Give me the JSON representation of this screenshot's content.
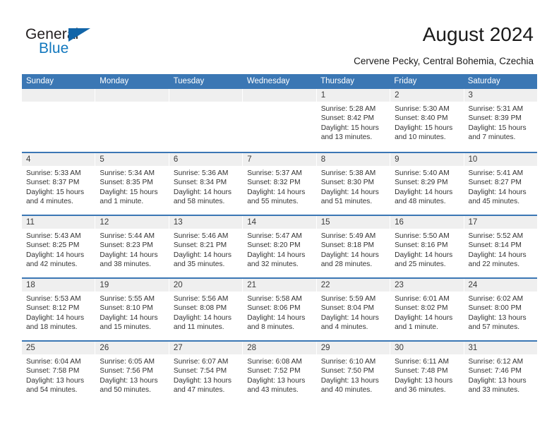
{
  "brand": {
    "name_top": "General",
    "name_bottom": "Blue",
    "accent_color": "#1278be",
    "triangle_color": "#1265a8"
  },
  "header": {
    "title": "August 2024",
    "subtitle": "Cervene Pecky, Central Bohemia, Czechia"
  },
  "theme": {
    "header_blue": "#3b77b4",
    "daynum_band_gray": "#efefef",
    "text_color": "#333333"
  },
  "weekdays": [
    "Sunday",
    "Monday",
    "Tuesday",
    "Wednesday",
    "Thursday",
    "Friday",
    "Saturday"
  ],
  "weeks": [
    [
      {
        "day": "",
        "empty": true
      },
      {
        "day": "",
        "empty": true
      },
      {
        "day": "",
        "empty": true
      },
      {
        "day": "",
        "empty": true
      },
      {
        "day": "1",
        "sunrise": "Sunrise: 5:28 AM",
        "sunset": "Sunset: 8:42 PM",
        "daylight1": "Daylight: 15 hours",
        "daylight2": "and 13 minutes."
      },
      {
        "day": "2",
        "sunrise": "Sunrise: 5:30 AM",
        "sunset": "Sunset: 8:40 PM",
        "daylight1": "Daylight: 15 hours",
        "daylight2": "and 10 minutes."
      },
      {
        "day": "3",
        "sunrise": "Sunrise: 5:31 AM",
        "sunset": "Sunset: 8:39 PM",
        "daylight1": "Daylight: 15 hours",
        "daylight2": "and 7 minutes."
      }
    ],
    [
      {
        "day": "4",
        "sunrise": "Sunrise: 5:33 AM",
        "sunset": "Sunset: 8:37 PM",
        "daylight1": "Daylight: 15 hours",
        "daylight2": "and 4 minutes."
      },
      {
        "day": "5",
        "sunrise": "Sunrise: 5:34 AM",
        "sunset": "Sunset: 8:35 PM",
        "daylight1": "Daylight: 15 hours",
        "daylight2": "and 1 minute."
      },
      {
        "day": "6",
        "sunrise": "Sunrise: 5:36 AM",
        "sunset": "Sunset: 8:34 PM",
        "daylight1": "Daylight: 14 hours",
        "daylight2": "and 58 minutes."
      },
      {
        "day": "7",
        "sunrise": "Sunrise: 5:37 AM",
        "sunset": "Sunset: 8:32 PM",
        "daylight1": "Daylight: 14 hours",
        "daylight2": "and 55 minutes."
      },
      {
        "day": "8",
        "sunrise": "Sunrise: 5:38 AM",
        "sunset": "Sunset: 8:30 PM",
        "daylight1": "Daylight: 14 hours",
        "daylight2": "and 51 minutes."
      },
      {
        "day": "9",
        "sunrise": "Sunrise: 5:40 AM",
        "sunset": "Sunset: 8:29 PM",
        "daylight1": "Daylight: 14 hours",
        "daylight2": "and 48 minutes."
      },
      {
        "day": "10",
        "sunrise": "Sunrise: 5:41 AM",
        "sunset": "Sunset: 8:27 PM",
        "daylight1": "Daylight: 14 hours",
        "daylight2": "and 45 minutes."
      }
    ],
    [
      {
        "day": "11",
        "sunrise": "Sunrise: 5:43 AM",
        "sunset": "Sunset: 8:25 PM",
        "daylight1": "Daylight: 14 hours",
        "daylight2": "and 42 minutes."
      },
      {
        "day": "12",
        "sunrise": "Sunrise: 5:44 AM",
        "sunset": "Sunset: 8:23 PM",
        "daylight1": "Daylight: 14 hours",
        "daylight2": "and 38 minutes."
      },
      {
        "day": "13",
        "sunrise": "Sunrise: 5:46 AM",
        "sunset": "Sunset: 8:21 PM",
        "daylight1": "Daylight: 14 hours",
        "daylight2": "and 35 minutes."
      },
      {
        "day": "14",
        "sunrise": "Sunrise: 5:47 AM",
        "sunset": "Sunset: 8:20 PM",
        "daylight1": "Daylight: 14 hours",
        "daylight2": "and 32 minutes."
      },
      {
        "day": "15",
        "sunrise": "Sunrise: 5:49 AM",
        "sunset": "Sunset: 8:18 PM",
        "daylight1": "Daylight: 14 hours",
        "daylight2": "and 28 minutes."
      },
      {
        "day": "16",
        "sunrise": "Sunrise: 5:50 AM",
        "sunset": "Sunset: 8:16 PM",
        "daylight1": "Daylight: 14 hours",
        "daylight2": "and 25 minutes."
      },
      {
        "day": "17",
        "sunrise": "Sunrise: 5:52 AM",
        "sunset": "Sunset: 8:14 PM",
        "daylight1": "Daylight: 14 hours",
        "daylight2": "and 22 minutes."
      }
    ],
    [
      {
        "day": "18",
        "sunrise": "Sunrise: 5:53 AM",
        "sunset": "Sunset: 8:12 PM",
        "daylight1": "Daylight: 14 hours",
        "daylight2": "and 18 minutes."
      },
      {
        "day": "19",
        "sunrise": "Sunrise: 5:55 AM",
        "sunset": "Sunset: 8:10 PM",
        "daylight1": "Daylight: 14 hours",
        "daylight2": "and 15 minutes."
      },
      {
        "day": "20",
        "sunrise": "Sunrise: 5:56 AM",
        "sunset": "Sunset: 8:08 PM",
        "daylight1": "Daylight: 14 hours",
        "daylight2": "and 11 minutes."
      },
      {
        "day": "21",
        "sunrise": "Sunrise: 5:58 AM",
        "sunset": "Sunset: 8:06 PM",
        "daylight1": "Daylight: 14 hours",
        "daylight2": "and 8 minutes."
      },
      {
        "day": "22",
        "sunrise": "Sunrise: 5:59 AM",
        "sunset": "Sunset: 8:04 PM",
        "daylight1": "Daylight: 14 hours",
        "daylight2": "and 4 minutes."
      },
      {
        "day": "23",
        "sunrise": "Sunrise: 6:01 AM",
        "sunset": "Sunset: 8:02 PM",
        "daylight1": "Daylight: 14 hours",
        "daylight2": "and 1 minute."
      },
      {
        "day": "24",
        "sunrise": "Sunrise: 6:02 AM",
        "sunset": "Sunset: 8:00 PM",
        "daylight1": "Daylight: 13 hours",
        "daylight2": "and 57 minutes."
      }
    ],
    [
      {
        "day": "25",
        "sunrise": "Sunrise: 6:04 AM",
        "sunset": "Sunset: 7:58 PM",
        "daylight1": "Daylight: 13 hours",
        "daylight2": "and 54 minutes."
      },
      {
        "day": "26",
        "sunrise": "Sunrise: 6:05 AM",
        "sunset": "Sunset: 7:56 PM",
        "daylight1": "Daylight: 13 hours",
        "daylight2": "and 50 minutes."
      },
      {
        "day": "27",
        "sunrise": "Sunrise: 6:07 AM",
        "sunset": "Sunset: 7:54 PM",
        "daylight1": "Daylight: 13 hours",
        "daylight2": "and 47 minutes."
      },
      {
        "day": "28",
        "sunrise": "Sunrise: 6:08 AM",
        "sunset": "Sunset: 7:52 PM",
        "daylight1": "Daylight: 13 hours",
        "daylight2": "and 43 minutes."
      },
      {
        "day": "29",
        "sunrise": "Sunrise: 6:10 AM",
        "sunset": "Sunset: 7:50 PM",
        "daylight1": "Daylight: 13 hours",
        "daylight2": "and 40 minutes."
      },
      {
        "day": "30",
        "sunrise": "Sunrise: 6:11 AM",
        "sunset": "Sunset: 7:48 PM",
        "daylight1": "Daylight: 13 hours",
        "daylight2": "and 36 minutes."
      },
      {
        "day": "31",
        "sunrise": "Sunrise: 6:12 AM",
        "sunset": "Sunset: 7:46 PM",
        "daylight1": "Daylight: 13 hours",
        "daylight2": "and 33 minutes."
      }
    ]
  ]
}
